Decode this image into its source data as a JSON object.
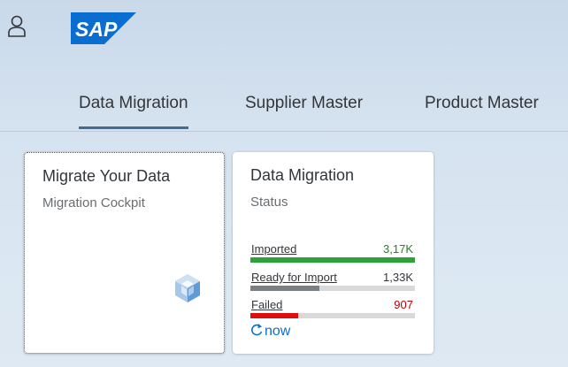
{
  "header": {
    "logo_text": "SAP",
    "brand_color": "#0a6ed1"
  },
  "tabs": [
    {
      "label": "Data Migration",
      "active": true
    },
    {
      "label": "Supplier Master",
      "active": false
    },
    {
      "label": "Product Master",
      "active": false
    }
  ],
  "tiles": {
    "migrate": {
      "title": "Migrate Your Data",
      "subtitle": "Migration Cockpit",
      "icon": "cube-icon"
    },
    "status": {
      "title": "Data Migration",
      "subtitle": "Status",
      "rows": [
        {
          "label": "Imported",
          "value": "3,17K",
          "value_color": "#2b7c2b",
          "bar_color": "#2ba339",
          "fraction": 1.0
        },
        {
          "label": "Ready for Import",
          "value": "1,33K",
          "value_color": "#32363a",
          "bar_color": "#7a7f84",
          "fraction": 0.42
        },
        {
          "label": "Failed",
          "value": "907",
          "value_color": "#bb0000",
          "bar_color": "#e00d0d",
          "fraction": 0.29
        }
      ],
      "refresh_label": "now"
    }
  }
}
